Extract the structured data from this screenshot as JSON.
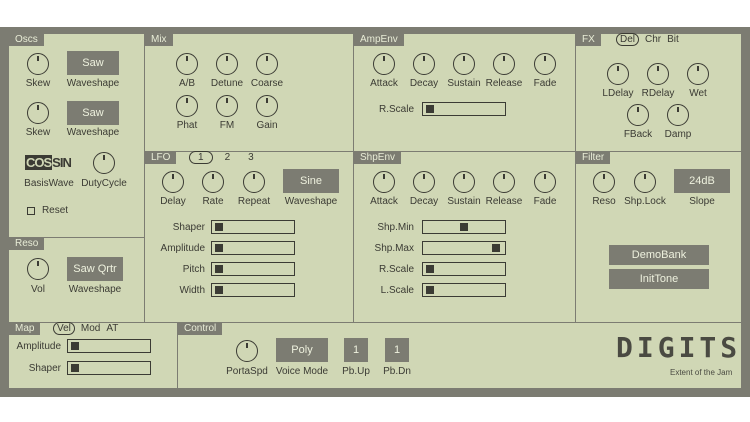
{
  "oscs": {
    "title": "Oscs",
    "skew1": "Skew",
    "wave1_btn": "Saw",
    "wave1_label": "Waveshape",
    "skew2": "Skew",
    "wave2_btn": "Saw",
    "wave2_label": "Waveshape",
    "basis_a": "COS",
    "basis_b": "SIN",
    "basis_label": "BasisWave",
    "duty_label": "DutyCycle",
    "reset": "Reset"
  },
  "mix": {
    "title": "Mix",
    "knobs": [
      "A/B",
      "Detune",
      "Coarse",
      "Phat",
      "FM",
      "Gain"
    ]
  },
  "ampenv": {
    "title": "AmpEnv",
    "knobs": [
      "Attack",
      "Decay",
      "Sustain",
      "Release",
      "Fade"
    ],
    "rscale": "R.Scale",
    "rscale_value": 0.02
  },
  "fx": {
    "title": "FX",
    "tabs": [
      "Del",
      "Chr",
      "Bit"
    ],
    "knobs": [
      "LDelay",
      "RDelay",
      "Wet",
      "FBack",
      "Damp"
    ]
  },
  "lfo": {
    "title": "LFO",
    "tabs": [
      "1",
      "2",
      "3"
    ],
    "knobs": [
      "Delay",
      "Rate",
      "Repeat"
    ],
    "wave_btn": "Sine",
    "wave_label": "Waveshape",
    "sliders": [
      {
        "label": "Shaper",
        "value": 0.02
      },
      {
        "label": "Amplitude",
        "value": 0.02
      },
      {
        "label": "Pitch",
        "value": 0.02
      },
      {
        "label": "Width",
        "value": 0.02
      }
    ]
  },
  "shpenv": {
    "title": "ShpEnv",
    "knobs": [
      "Attack",
      "Decay",
      "Sustain",
      "Release",
      "Fade"
    ],
    "sliders": [
      {
        "label": "Shp.Min",
        "value": 0.5
      },
      {
        "label": "Shp.Max",
        "value": 0.95
      },
      {
        "label": "R.Scale",
        "value": 0.02
      },
      {
        "label": "L.Scale",
        "value": 0.02
      }
    ]
  },
  "filter": {
    "title": "Filter",
    "knobs": [
      "Reso",
      "Shp.Lock"
    ],
    "slope_btn": "24dB",
    "slope_label": "Slope",
    "demobank": "DemoBank",
    "inittone": "InitTone"
  },
  "reso": {
    "title": "Reso",
    "vol": "Vol",
    "wave_btn": "Saw Qrtr",
    "wave_label": "Waveshape"
  },
  "map": {
    "title": "Map",
    "tabs": [
      "Vel",
      "Mod",
      "AT"
    ],
    "sliders": [
      {
        "label": "Amplitude",
        "value": 0.02
      },
      {
        "label": "Shaper",
        "value": 0.02
      }
    ]
  },
  "control": {
    "title": "Control",
    "porta": "PortaSpd",
    "voice_btn": "Poly",
    "voice_label": "Voice Mode",
    "pbup_btn": "1",
    "pbup_label": "Pb.Up",
    "pbdn_btn": "1",
    "pbdn_label": "Pb.Dn"
  },
  "brand": {
    "logo": "DIGITS",
    "subtitle": "Extent of the Jam"
  },
  "colors": {
    "panel": "#d0d7b5",
    "frame": "#7c7c72",
    "ink": "#3b3b34"
  }
}
